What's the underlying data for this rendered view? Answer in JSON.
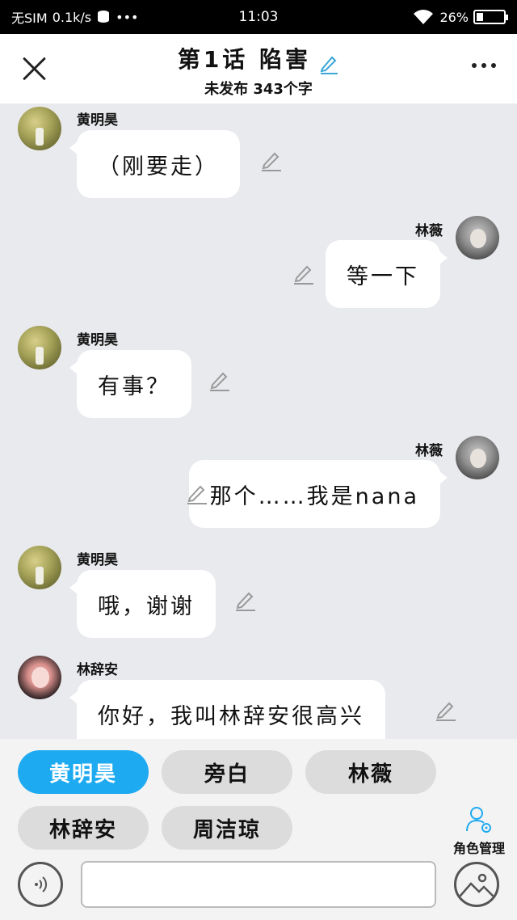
{
  "status_bar": {
    "carrier": "无SIM",
    "net_speed": "0.1k/s",
    "time": "11:03",
    "battery": "26%",
    "battery_level": 0.26
  },
  "header": {
    "title": "第1话 陷害",
    "subtitle": "未发布 343个字"
  },
  "messages": [
    {
      "speaker": "黄明昊",
      "text": "（刚要走）",
      "side": "left"
    },
    {
      "speaker": "林薇",
      "text": "等一下",
      "side": "right"
    },
    {
      "speaker": "黄明昊",
      "text": "有事？",
      "side": "left"
    },
    {
      "speaker": "林薇",
      "text": "那个……我是nana",
      "side": "right"
    },
    {
      "speaker": "黄明昊",
      "text": "哦，谢谢",
      "side": "left"
    },
    {
      "speaker": "林辞安",
      "text": "你好，我叫林辞安很高兴",
      "side": "left"
    }
  ],
  "roles": [
    "黄明昊",
    "旁白",
    "林薇",
    "林辞安",
    "周洁琼"
  ],
  "active_role": "黄明昊",
  "role_manage_label": "角色管理",
  "colors": {
    "accent": "#1eaaf1",
    "background": "#e9eaee",
    "pencil": "#9a9a9a",
    "title_pencil": "#3aa6d6"
  }
}
